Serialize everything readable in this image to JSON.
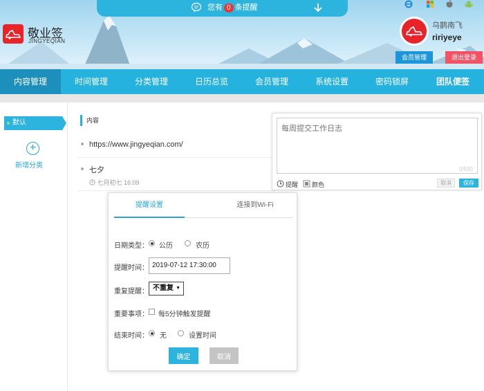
{
  "notice": {
    "prefix": "您有",
    "count": "0",
    "suffix": "条提醒"
  },
  "brand": {
    "name": "敬业签",
    "sub": "JINGYEQIAN"
  },
  "colors": {
    "accent": "#25b2de",
    "nav_active": "#1d8fbc",
    "logo": "#e8232a",
    "member_btn": "#1d95d9",
    "logout_btn": "#f25266",
    "save_btn": "#2cb3de"
  },
  "os_icons": [
    "ie-icon",
    "windows-icon",
    "apple-icon",
    "android-icon"
  ],
  "user": {
    "nickname": "乌鹊南飞",
    "username": "ririyeye",
    "member_btn": "会员管理",
    "logout_btn": "退出登录"
  },
  "nav": [
    "内容管理",
    "时间管理",
    "分类管理",
    "日历总览",
    "会员管理",
    "系统设置",
    "密码锁屏",
    "团队便签"
  ],
  "sidebar": {
    "default": "默认",
    "add": "新增分类"
  },
  "content": {
    "header": "内容",
    "items": [
      {
        "text": "https://www.jingyeqian.com/",
        "meta": ""
      },
      {
        "text": "七夕",
        "meta": "七月初七 16:09"
      }
    ]
  },
  "editor": {
    "placeholder": "每周提交工作日志",
    "counter": "0/500",
    "remind": "提醒",
    "color": "颜色",
    "cancel": "取消",
    "save": "保存"
  },
  "dialog": {
    "tab_active": "提醒设置",
    "tab_other": "连接到Wi-Fi",
    "date_type_label": "日期类型：",
    "opt_solar": "公历",
    "opt_lunar": "农历",
    "remind_time_label": "提醒时间：",
    "remind_time_value": "2019-07-12 17:30:00",
    "repeat_label": "重复提醒：",
    "repeat_value": "不重复",
    "important_label": "重要事项：",
    "important_opt": "每5分钟触发提醒",
    "end_label": "结束时间：",
    "end_none": "无",
    "end_set": "设置时间",
    "ok": "确定",
    "cancel": "取消"
  }
}
